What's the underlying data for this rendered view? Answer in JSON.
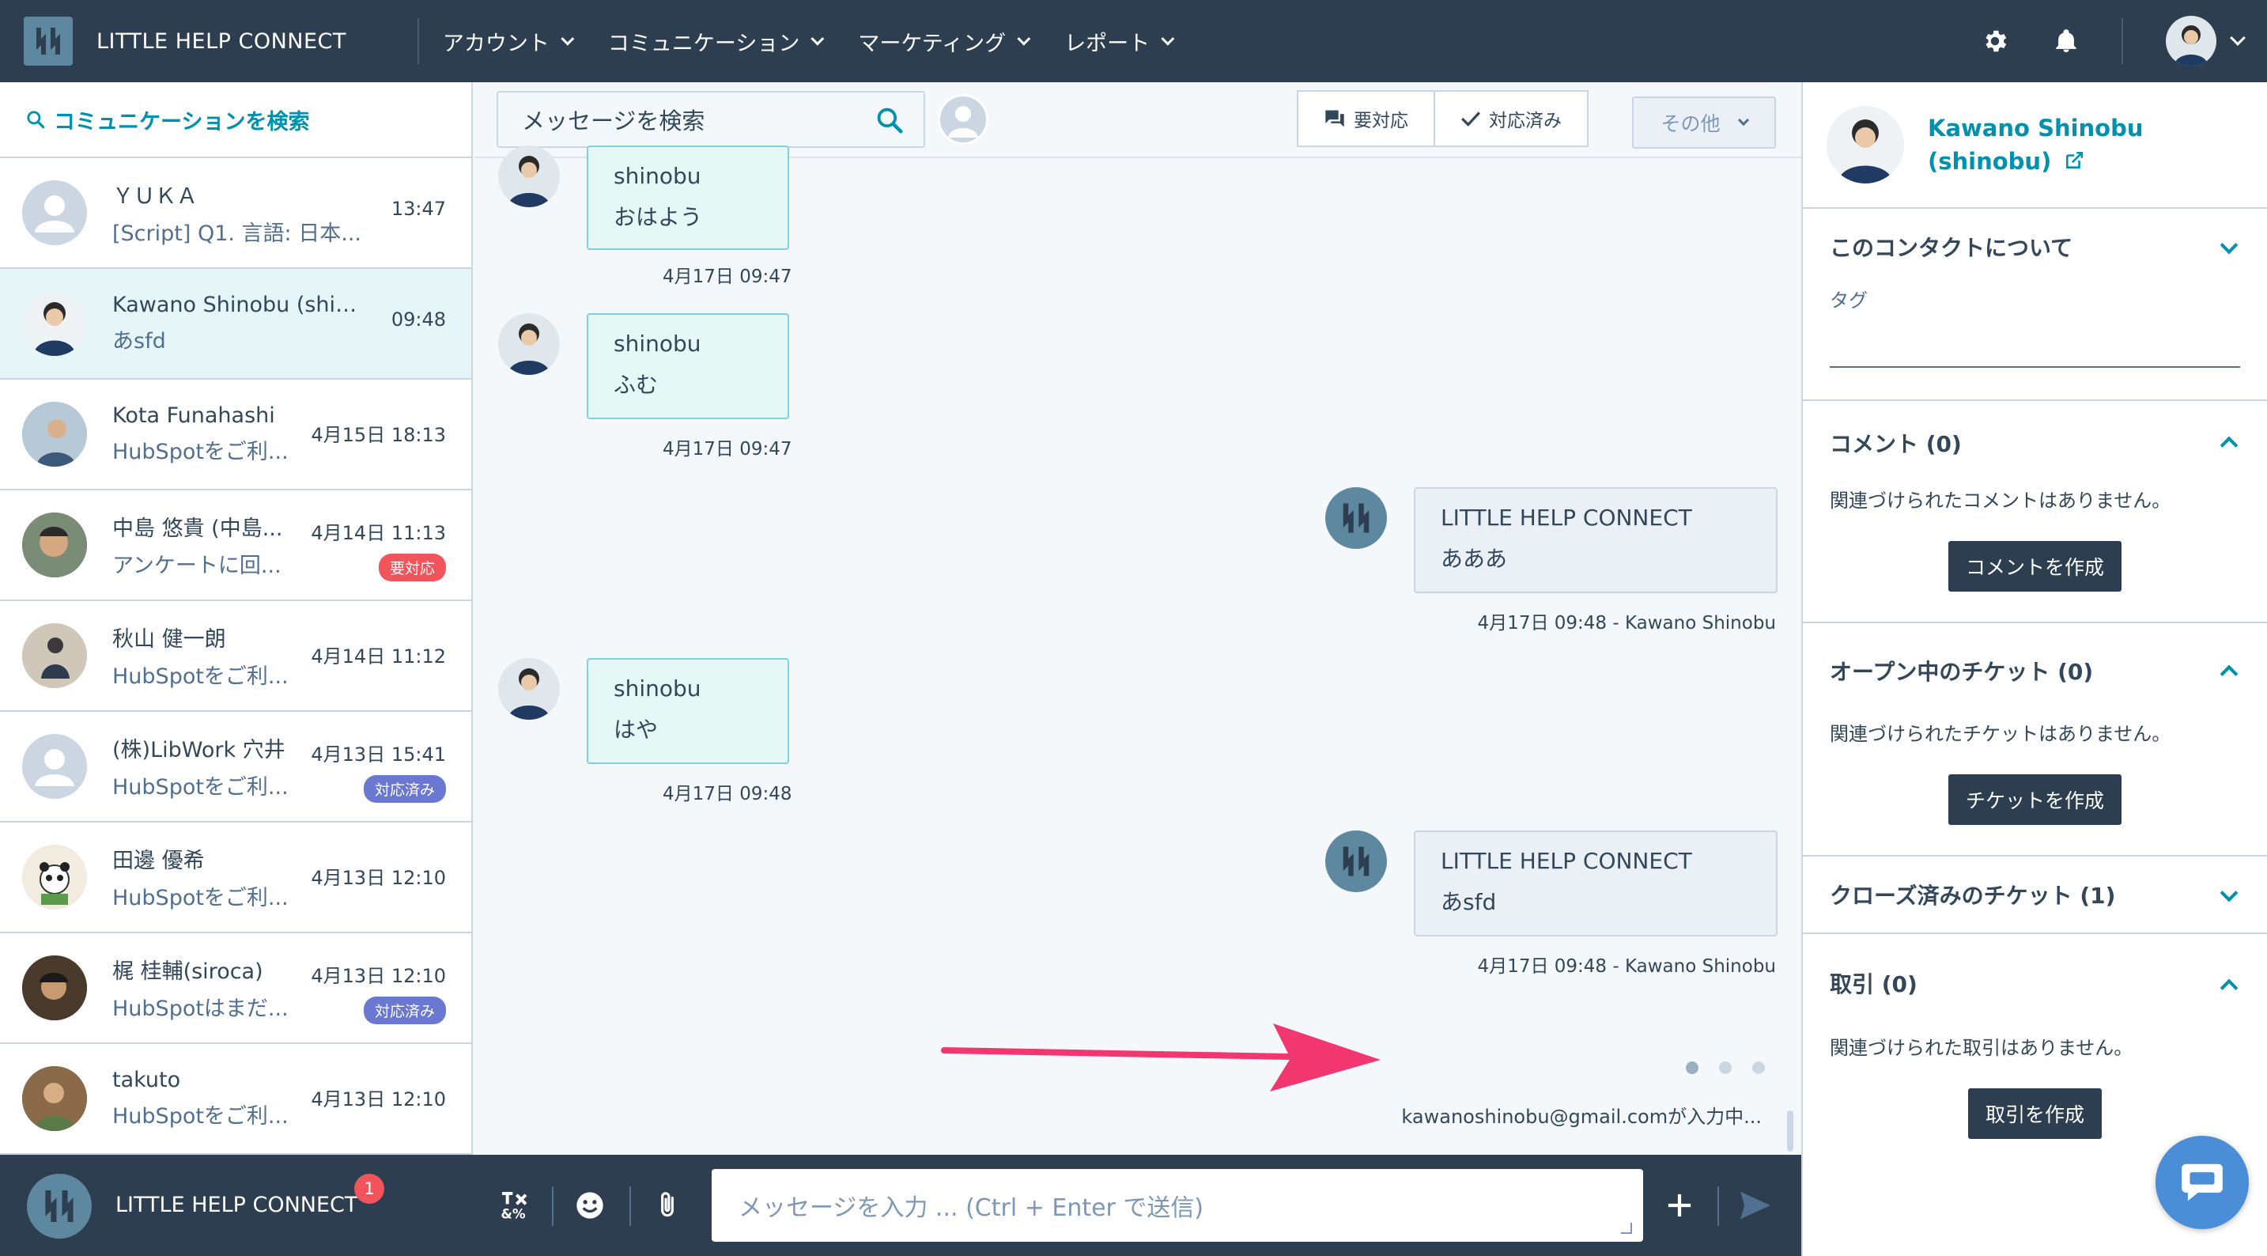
{
  "app": {
    "title": "LITTLE HELP CONNECT"
  },
  "nav": [
    {
      "label": "アカウント"
    },
    {
      "label": "コミュニケーション"
    },
    {
      "label": "マーケティング"
    },
    {
      "label": "レポート"
    }
  ],
  "left": {
    "search_label": "コミュニケーションを検索",
    "conversations": [
      {
        "name": "ＹＵＫＡ",
        "preview": "[Script] Q1. 言語: 日本...",
        "time": "13:47",
        "badge": ""
      },
      {
        "name": "Kawano Shinobu (shin...",
        "preview": "あsfd",
        "time": "09:48",
        "badge": ""
      },
      {
        "name": "Kota Funahashi",
        "preview": "HubSpotをご利...",
        "time": "4月15日 18:13",
        "badge": ""
      },
      {
        "name": "中島 悠貴 (中島...",
        "preview": "アンケートに回...",
        "time": "4月14日 11:13",
        "badge": "要対応"
      },
      {
        "name": "秋山 健一朗",
        "preview": "HubSpotをご利...",
        "time": "4月14日 11:12",
        "badge": ""
      },
      {
        "name": "(株)LibWork 穴井",
        "preview": "HubSpotをご利...",
        "time": "4月13日 15:41",
        "badge": "対応済み"
      },
      {
        "name": "田邊 優希",
        "preview": "HubSpotをご利...",
        "time": "4月13日 12:10",
        "badge": ""
      },
      {
        "name": "梶 桂輔(siroca)",
        "preview": "HubSpotはまだ...",
        "time": "4月13日 12:10",
        "badge": "対応済み"
      },
      {
        "name": "takuto",
        "preview": "HubSpotをご利...",
        "time": "4月13日 12:10",
        "badge": ""
      }
    ]
  },
  "center": {
    "search_placeholder": "メッセージを検索",
    "btn_needs_action": "要対応",
    "btn_done": "対応済み",
    "btn_other": "その他",
    "messages": [
      {
        "who": "shinobu",
        "body": "おはよう",
        "ts": "4月17日 09:47"
      },
      {
        "who": "shinobu",
        "body": "ふむ",
        "ts": "4月17日 09:47"
      },
      {
        "who": "LITTLE HELP CONNECT",
        "body": "あああ",
        "ts": "4月17日 09:48 - Kawano Shinobu"
      },
      {
        "who": "shinobu",
        "body": "はや",
        "ts": "4月17日 09:48"
      },
      {
        "who": "LITTLE HELP CONNECT",
        "body": "あsfd",
        "ts": "4月17日 09:48 - Kawano Shinobu"
      }
    ],
    "typing": "kawanoshinobu@gmail.comが入力中..."
  },
  "bottom": {
    "title": "LITTLE HELP CONNECT",
    "notif_count": "1",
    "composer_placeholder": "メッセージを入力 ... (Ctrl + Enter で送信)"
  },
  "right": {
    "contact_name_1": "Kawano Shinobu",
    "contact_name_2": "(shinobu)",
    "about_title": "このコンタクトについて",
    "tag_label": "タグ",
    "comments_title": "コメント (0)",
    "comments_empty": "関連づけられたコメントはありません。",
    "comments_btn": "コメントを作成",
    "tickets_title": "オープン中のチケット (0)",
    "tickets_empty": "関連づけられたチケットはありません。",
    "tickets_btn": "チケットを作成",
    "closed_title": "クローズ済みのチケット (1)",
    "deals_title": "取引 (0)",
    "deals_empty": "関連づけられた取引はありません。",
    "deals_btn": "取引を作成"
  },
  "colors": {
    "topbar": "#2d3e50",
    "accent": "#0091ae",
    "badge_red": "#f2545b",
    "badge_blue": "#6a78d1",
    "arrow": "#f2366f"
  }
}
